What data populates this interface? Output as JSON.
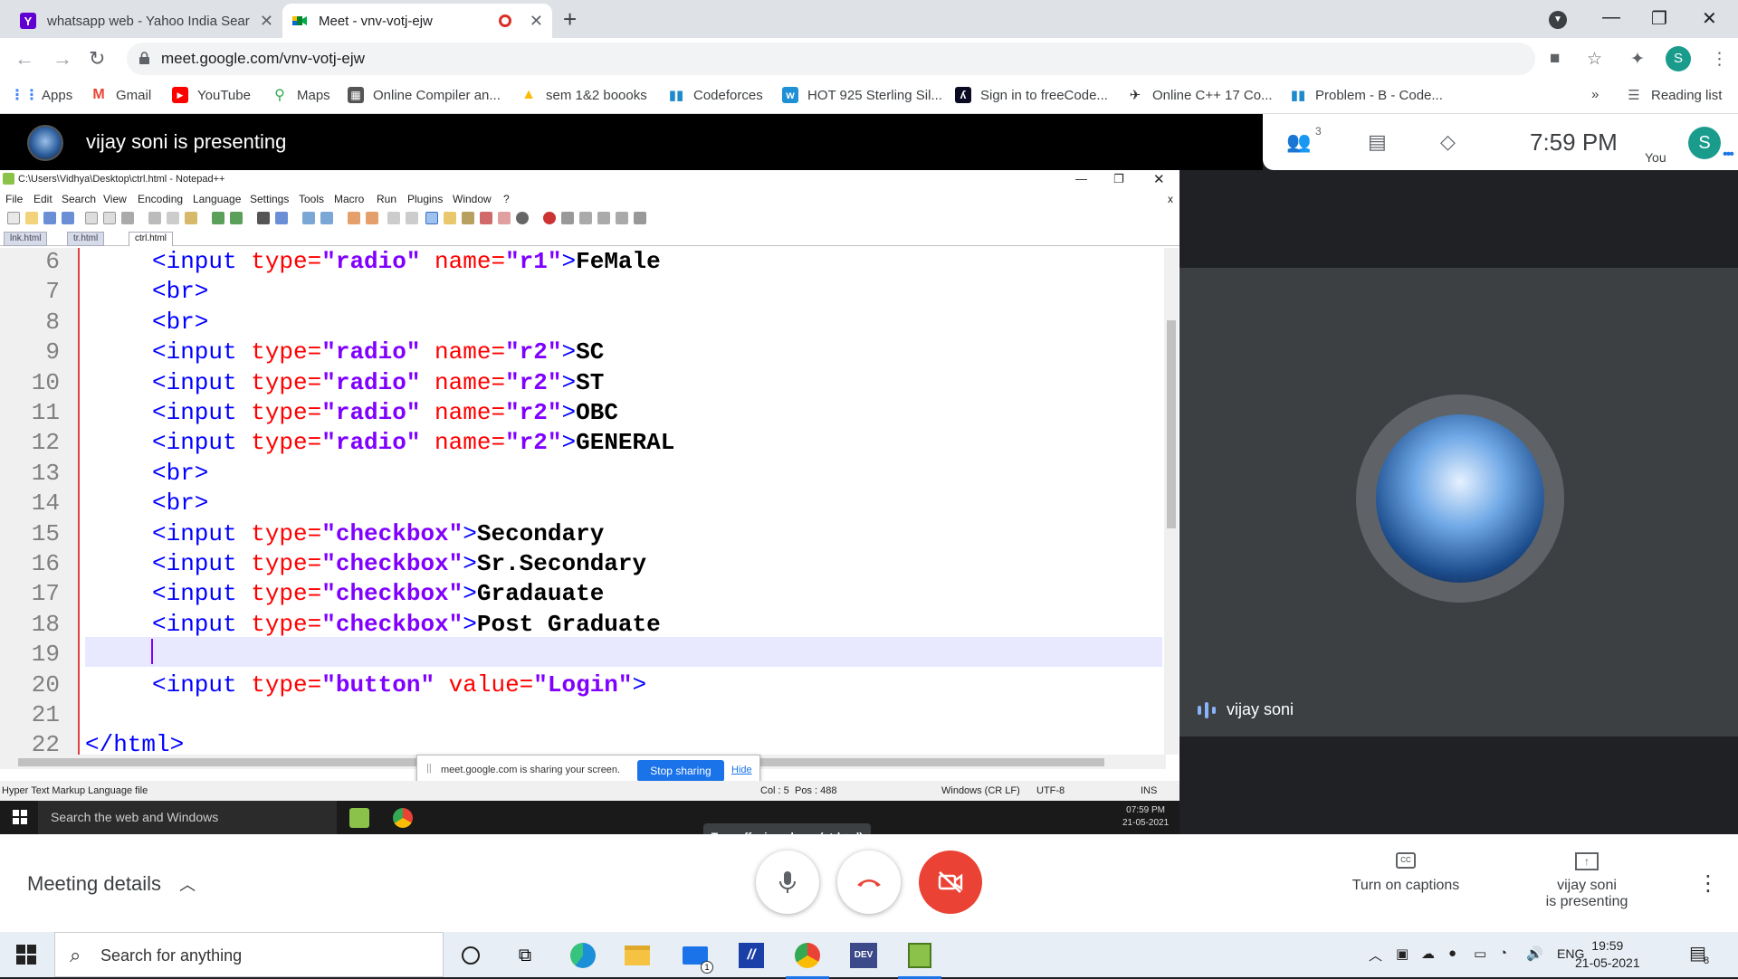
{
  "browser": {
    "tabs": [
      {
        "title": "whatsapp web - Yahoo India Sear",
        "favicon": "Y"
      },
      {
        "title": "Meet - vnv-votj-ejw",
        "favicon": "meet"
      }
    ],
    "url": "meet.google.com/vnv-votj-ejw",
    "profile_initial": "S",
    "bookmarks": [
      "Apps",
      "Gmail",
      "YouTube",
      "Maps",
      "Online Compiler an...",
      "sem 1&2 boooks",
      "Codeforces",
      "HOT 925 Sterling Sil...",
      "Sign in to freeCode...",
      "Online C++ 17 Co...",
      "Problem - B - Code..."
    ],
    "reading_list": "Reading list",
    "overflow": "»"
  },
  "meet": {
    "presenting_title": "vijay soni is presenting",
    "participants_count": "3",
    "time": "7:59 PM",
    "you_label": "You",
    "you_initial": "S",
    "tile_name": "vijay soni",
    "tooltip": "Turn off microphone (ctrl + d)",
    "meeting_details": "Meeting details",
    "captions_label": "Turn on captions",
    "presenting_line1": "vijay soni",
    "presenting_line2": "is presenting"
  },
  "npp": {
    "title": "C:\\Users\\Vidhya\\Desktop\\ctrl.html - Notepad++",
    "menu": [
      "File",
      "Edit",
      "Search",
      "View",
      "Encoding",
      "Language",
      "Settings",
      "Tools",
      "Macro",
      "Run",
      "Plugins",
      "Window",
      "?"
    ],
    "tabs": [
      "lnk.html",
      "tr.html",
      "ctrl.html"
    ],
    "lines": [
      {
        "n": "6",
        "tag": "<input ",
        "a1": "type=",
        "v1": "\"radio\"",
        "a2": " name=",
        "v2": "\"r1\"",
        "close": ">",
        "text": "FeMale"
      },
      {
        "n": "7",
        "tag": "<br>",
        "a1": "",
        "v1": "",
        "a2": "",
        "v2": "",
        "close": "",
        "text": ""
      },
      {
        "n": "8",
        "tag": "<br>",
        "a1": "",
        "v1": "",
        "a2": "",
        "v2": "",
        "close": "",
        "text": ""
      },
      {
        "n": "9",
        "tag": "<input ",
        "a1": "type=",
        "v1": "\"radio\"",
        "a2": " name=",
        "v2": "\"r2\"",
        "close": ">",
        "text": "SC"
      },
      {
        "n": "10",
        "tag": "<input ",
        "a1": "type=",
        "v1": "\"radio\"",
        "a2": " name=",
        "v2": "\"r2\"",
        "close": ">",
        "text": "ST"
      },
      {
        "n": "11",
        "tag": "<input ",
        "a1": "type=",
        "v1": "\"radio\"",
        "a2": " name=",
        "v2": "\"r2\"",
        "close": ">",
        "text": "OBC"
      },
      {
        "n": "12",
        "tag": "<input ",
        "a1": "type=",
        "v1": "\"radio\"",
        "a2": " name=",
        "v2": "\"r2\"",
        "close": ">",
        "text": "GENERAL"
      },
      {
        "n": "13",
        "tag": "<br>",
        "a1": "",
        "v1": "",
        "a2": "",
        "v2": "",
        "close": "",
        "text": ""
      },
      {
        "n": "14",
        "tag": "<br>",
        "a1": "",
        "v1": "",
        "a2": "",
        "v2": "",
        "close": "",
        "text": ""
      },
      {
        "n": "15",
        "tag": "<input ",
        "a1": "type=",
        "v1": "\"checkbox\"",
        "a2": "",
        "v2": "",
        "close": ">",
        "text": "Secondary"
      },
      {
        "n": "16",
        "tag": "<input ",
        "a1": "type=",
        "v1": "\"checkbox\"",
        "a2": "",
        "v2": "",
        "close": ">",
        "text": "Sr.Secondary"
      },
      {
        "n": "17",
        "tag": "<input ",
        "a1": "type=",
        "v1": "\"checkbox\"",
        "a2": "",
        "v2": "",
        "close": ">",
        "text": "Gradauate"
      },
      {
        "n": "18",
        "tag": "<input ",
        "a1": "type=",
        "v1": "\"checkbox\"",
        "a2": "",
        "v2": "",
        "close": ">",
        "text": "Post Graduate"
      },
      {
        "n": "19",
        "tag": "",
        "a1": "",
        "v1": "",
        "a2": "",
        "v2": "",
        "close": "",
        "text": ""
      },
      {
        "n": "20",
        "tag": "<input ",
        "a1": "type=",
        "v1": "\"button\"",
        "a2": " value=",
        "v2": "\"Login\"",
        "close": ">",
        "text": ""
      },
      {
        "n": "21",
        "tag": "",
        "a1": "",
        "v1": "",
        "a2": "",
        "v2": "",
        "close": "",
        "text": ""
      },
      {
        "n": "22",
        "tag": "</html>",
        "a1": "",
        "v1": "",
        "a2": "",
        "v2": "",
        "close": "",
        "text": ""
      }
    ],
    "status_left": "Hyper Text Markup Language file",
    "status_pos": "Pos : 488",
    "status_col": "Col : 5",
    "status_eol": "Windows (CR LF)",
    "status_enc": "UTF-8",
    "status_ins": "INS",
    "share_msg": "meet.google.com is sharing your screen.",
    "stop_sharing": "Stop sharing",
    "hide": "Hide",
    "inner_search": "Search the web and Windows",
    "inner_time": "07:59 PM",
    "inner_date": "21-05-2021"
  },
  "taskbar": {
    "search_placeholder": "Search for anything",
    "lang": "ENG",
    "time": "19:59",
    "date": "21-05-2021",
    "notifications": "8",
    "mail_badge": "1"
  }
}
